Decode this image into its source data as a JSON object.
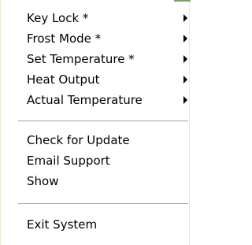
{
  "menu": {
    "submenu_items": [
      {
        "label": "Key Lock *"
      },
      {
        "label": "Frost Mode *"
      },
      {
        "label": "Set Temperature *"
      },
      {
        "label": "Heat Output"
      },
      {
        "label": "Actual Temperature"
      }
    ],
    "action_items": [
      {
        "label": "Check for Update"
      },
      {
        "label": "Email Support"
      },
      {
        "label": "Show"
      }
    ],
    "exit_item": {
      "label": "Exit System"
    }
  },
  "colors": {
    "text": "#000000",
    "background": "#ffffff",
    "separator": "#a0a0a0",
    "accent": "#7a9f6a"
  }
}
